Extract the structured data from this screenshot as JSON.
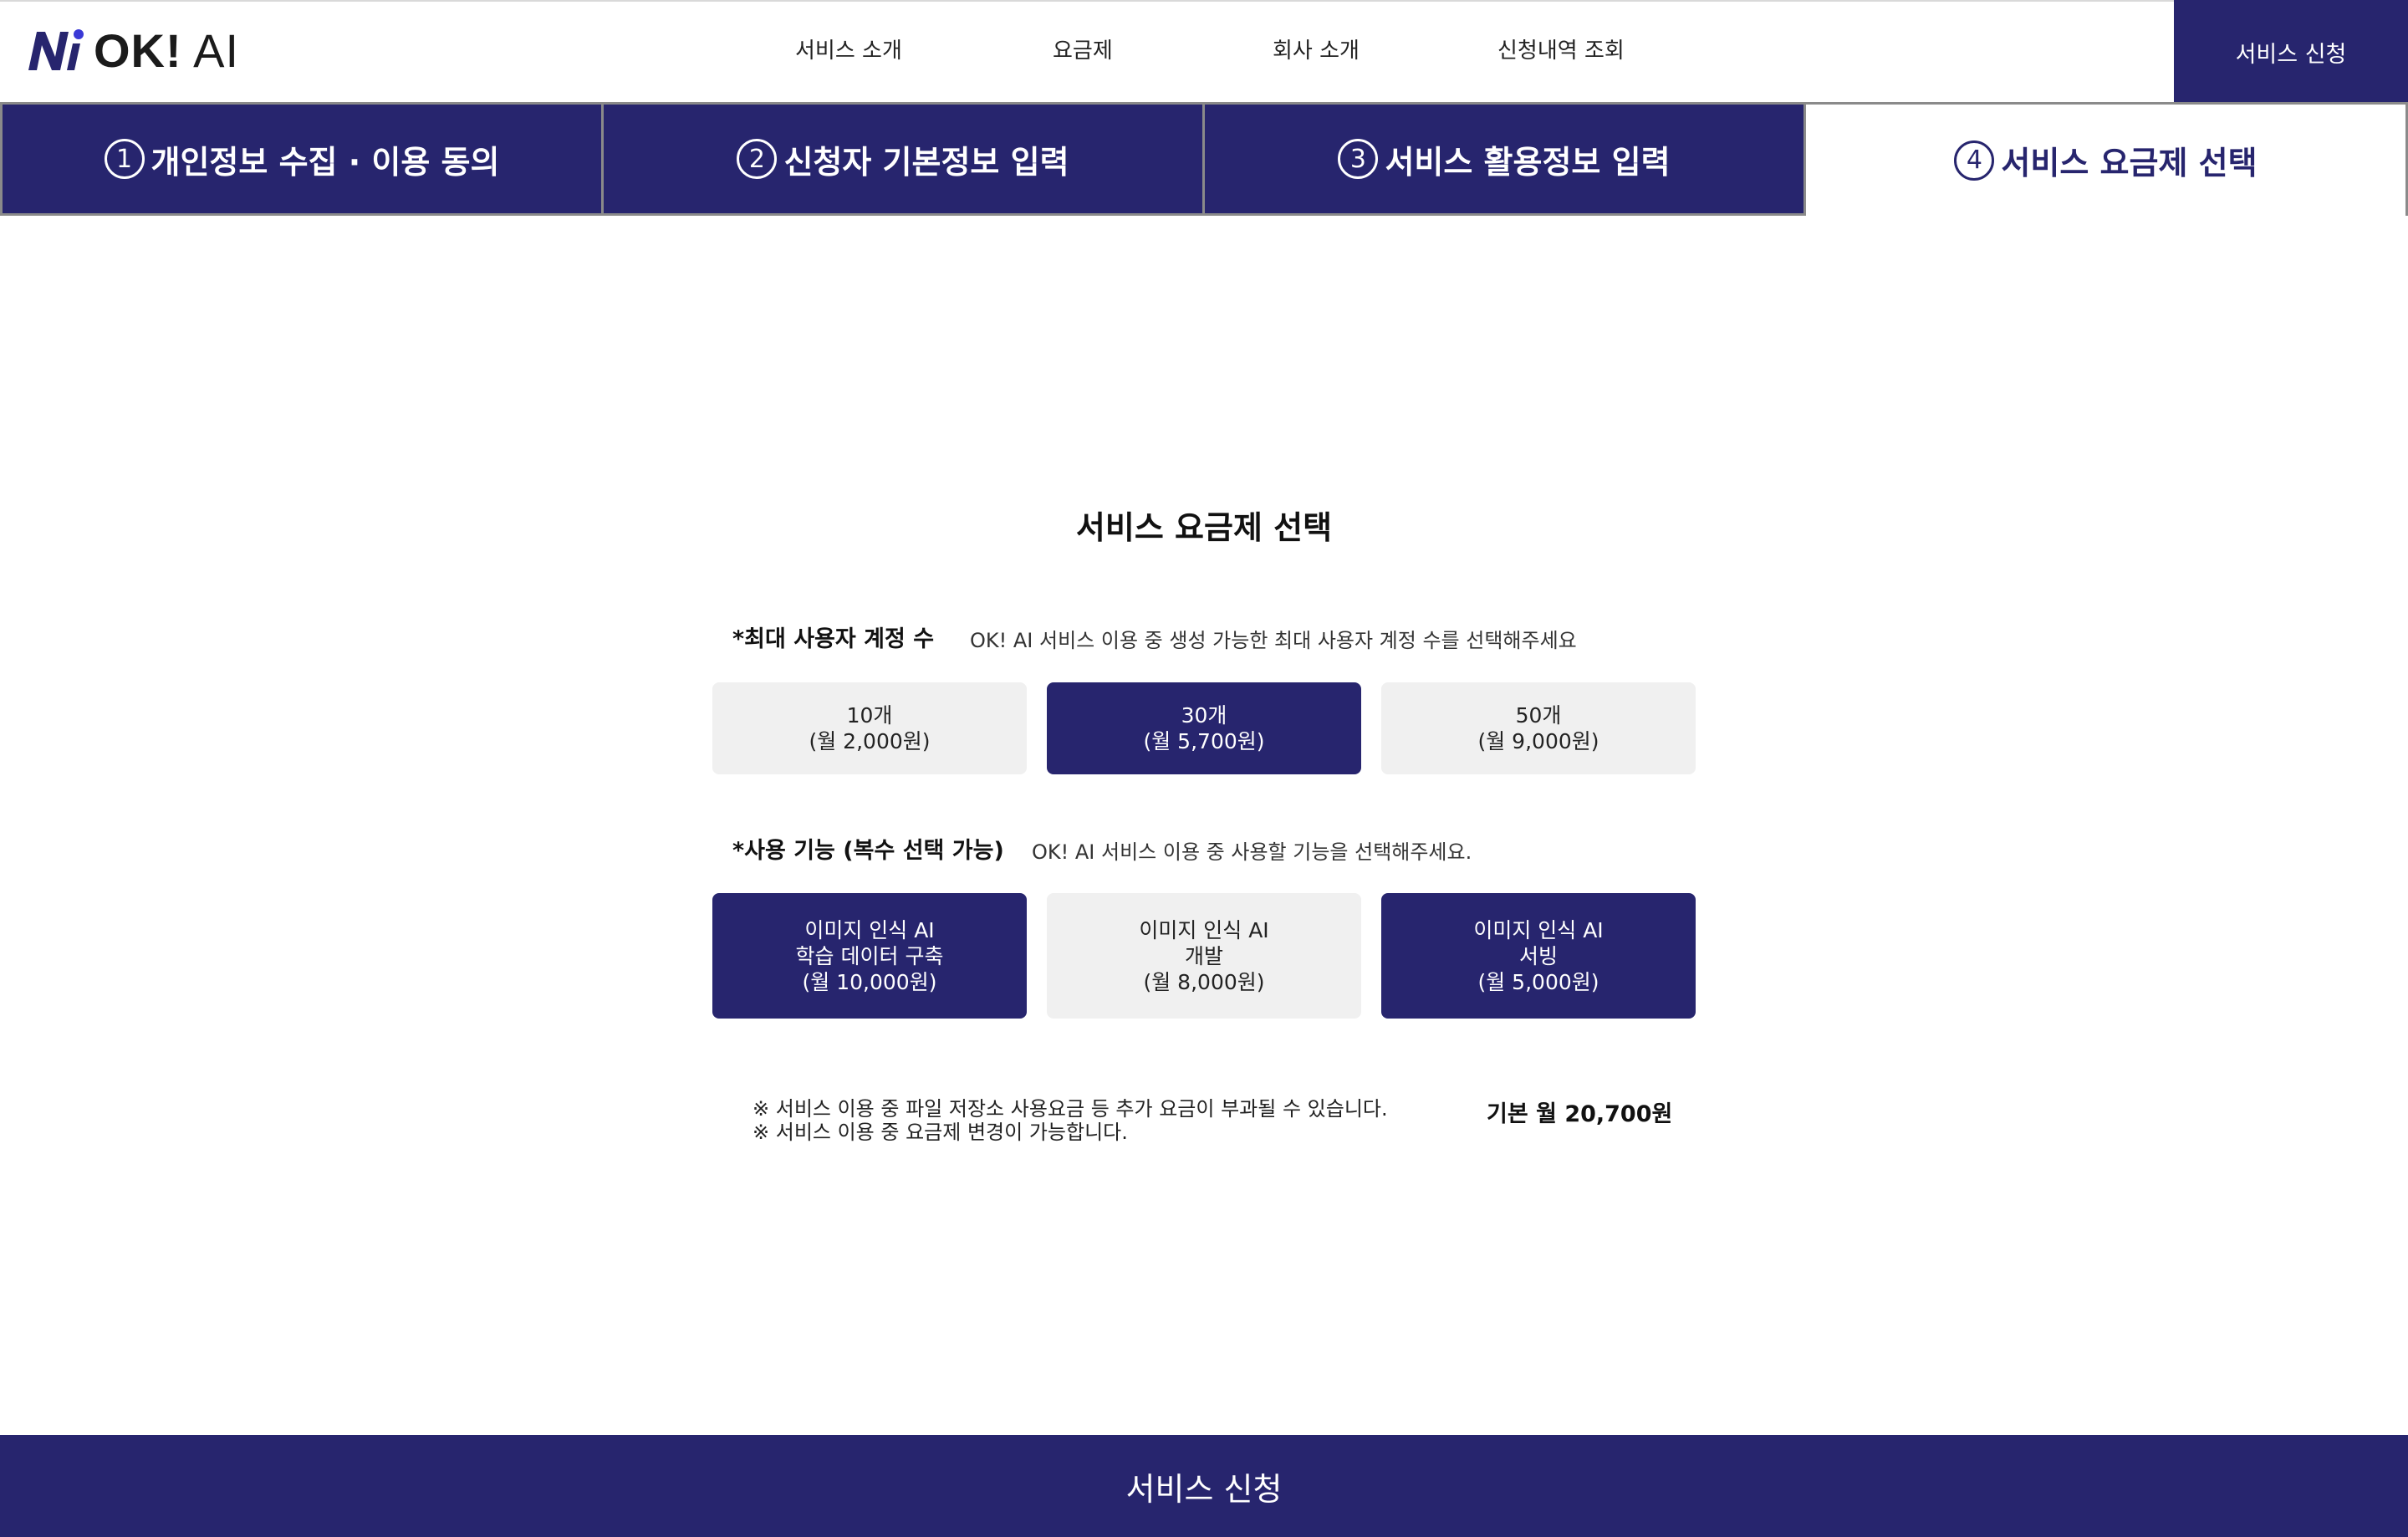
{
  "brand": {
    "logo_text_bold": "OK!",
    "logo_text_light": "AI"
  },
  "nav": {
    "items": [
      {
        "label": "서비스 소개"
      },
      {
        "label": "요금제"
      },
      {
        "label": "회사 소개"
      },
      {
        "label": "신청내역 조회"
      }
    ],
    "apply_label": "서비스 신청"
  },
  "steps": [
    {
      "num": "1",
      "label": "개인정보 수집 · 이용 동의",
      "active": false
    },
    {
      "num": "2",
      "label": "신청자 기본정보 입력",
      "active": false
    },
    {
      "num": "3",
      "label": "서비스 활용정보 입력",
      "active": false
    },
    {
      "num": "4",
      "label": "서비스 요금제 선택",
      "active": true
    }
  ],
  "main": {
    "title": "서비스 요금제 선택",
    "accounts": {
      "label": "*최대 사용자 계정 수",
      "description": "OK! AI 서비스 이용 중 생성 가능한 최대 사용자 계정 수를 선택해주세요",
      "options": [
        {
          "line1": "10개",
          "line2": "(월 2,000원)",
          "selected": false
        },
        {
          "line1": "30개",
          "line2": "(월 5,700원)",
          "selected": true
        },
        {
          "line1": "50개",
          "line2": "(월 9,000원)",
          "selected": false
        }
      ]
    },
    "features": {
      "label": "*사용 기능 (복수 선택 가능)",
      "description": "OK! AI 서비스 이용 중 사용할 기능을 선택해주세요.",
      "options": [
        {
          "line1": "이미지 인식 AI",
          "line2": "학습 데이터 구축",
          "line3": "(월 10,000원)",
          "selected": true
        },
        {
          "line1": "이미지 인식 AI",
          "line2": "개발",
          "line3": "(월 8,000원)",
          "selected": false
        },
        {
          "line1": "이미지 인식 AI",
          "line2": "서빙",
          "line3": "(월 5,000원)",
          "selected": true
        }
      ]
    },
    "notes": [
      "※ 서비스 이용 중 파일 저장소 사용요금 등 추가 요금이 부과될 수 있습니다.",
      "※ 서비스 이용 중 요금제 변경이 가능합니다."
    ],
    "total": "기본 월 20,700원"
  },
  "footer": {
    "apply_label": "서비스 신청"
  },
  "colors": {
    "primary": "#27256e",
    "option_bg": "#f0f0f0",
    "logo_accent": "#3a39d6"
  }
}
